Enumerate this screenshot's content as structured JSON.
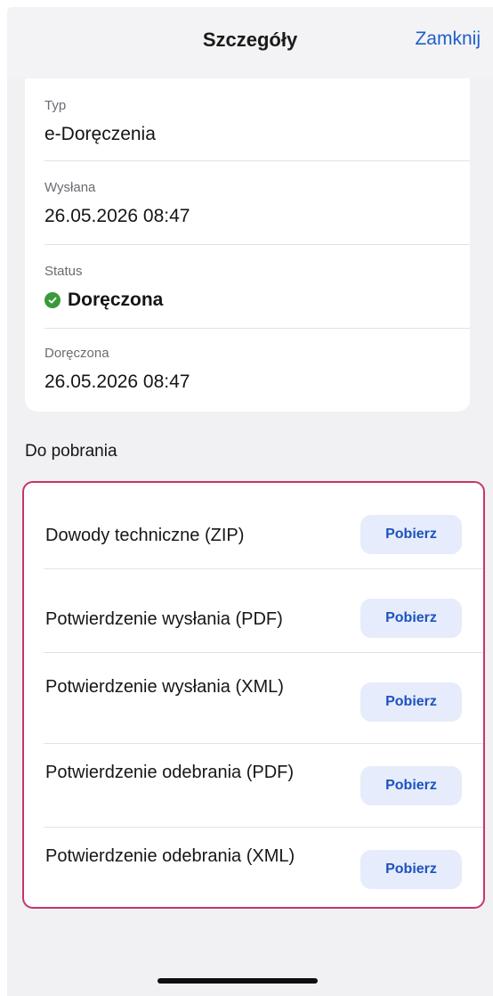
{
  "nav": {
    "title": "Szczegóły",
    "close_label": "Zamknij"
  },
  "details": {
    "type_label": "Typ",
    "type_value": "e-Doręczenia",
    "sent_label": "Wysłana",
    "sent_value": "26.05.2026 08:47",
    "status_label": "Status",
    "status_value": "Doręczona",
    "delivered_label": "Doręczona",
    "delivered_value": "26.05.2026 08:47"
  },
  "downloads": {
    "section_title": "Do pobrania",
    "items": [
      {
        "name": "Dowody techniczne (ZIP)",
        "button": "Pobierz"
      },
      {
        "name": "Potwierdzenie wysłania (PDF)",
        "button": "Pobierz"
      },
      {
        "name": "Potwierdzenie wysłania (XML)",
        "button": "Pobierz"
      },
      {
        "name": "Potwierdzenie odebrania (PDF)",
        "button": "Pobierz"
      },
      {
        "name": "Potwierdzenie odebrania (XML)",
        "button": "Pobierz"
      }
    ]
  },
  "colors": {
    "accent": "#1e5fc8",
    "button_bg": "#e6ecfb",
    "status_green": "#3a9a3a",
    "highlight_border": "#c8346a"
  },
  "icons": {
    "status": "check-circle-icon"
  }
}
